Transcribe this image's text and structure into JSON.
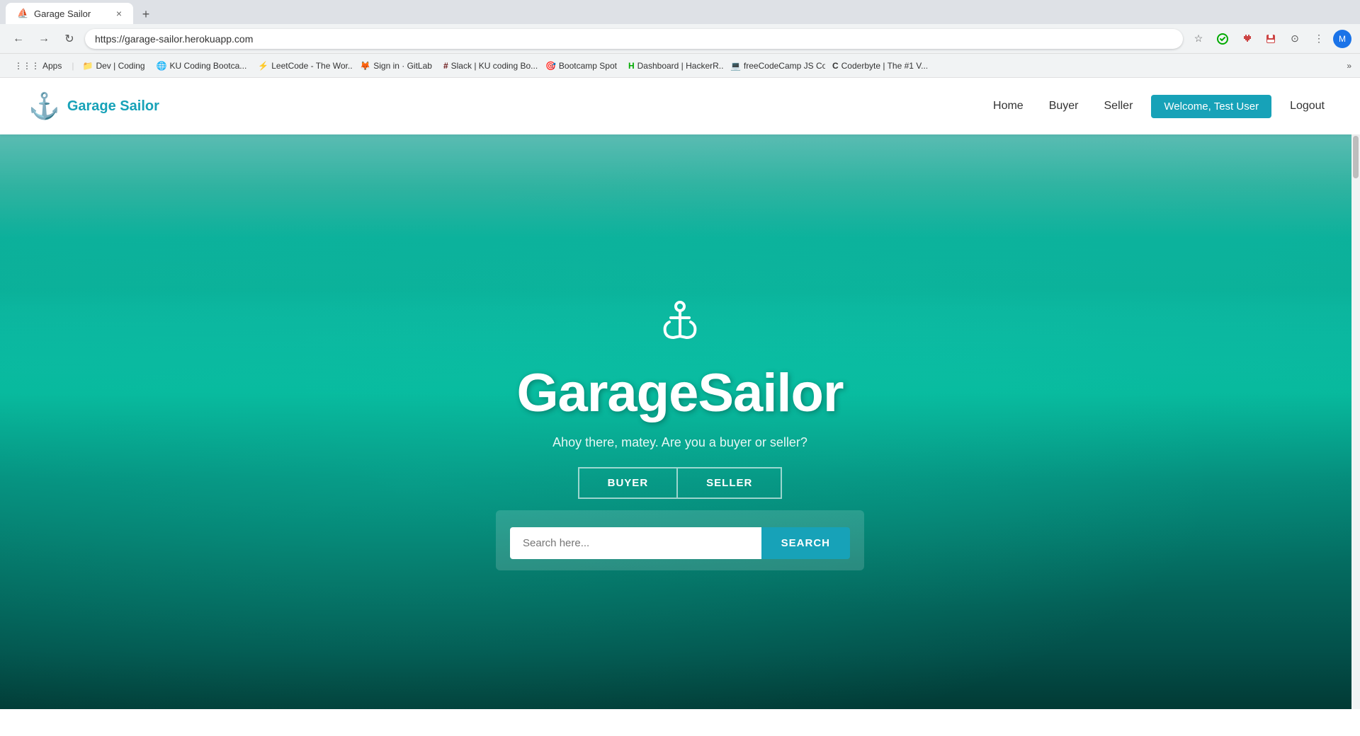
{
  "browser": {
    "tab": {
      "favicon": "⛵",
      "title": "Garage Sailor",
      "close": "×"
    },
    "new_tab": "+",
    "address": "https://garage-sailor.herokuapp.com",
    "nav": {
      "back": "←",
      "forward": "→",
      "refresh": "↻",
      "home": ""
    },
    "icons": {
      "star": "☆",
      "extensions": "",
      "more": "⋮"
    },
    "profile_initial": "M"
  },
  "bookmarks": {
    "apps_label": "Apps",
    "items": [
      {
        "icon": "📁",
        "label": "Dev | Coding"
      },
      {
        "icon": "🌐",
        "label": "KU Coding Bootca..."
      },
      {
        "icon": "⚡",
        "label": "LeetCode - The Wor..."
      },
      {
        "icon": "🦊",
        "label": "Sign in · GitLab"
      },
      {
        "icon": "#",
        "label": "Slack | KU coding Bo..."
      },
      {
        "icon": "🎯",
        "label": "Bootcamp Spot"
      },
      {
        "icon": "H",
        "label": "Dashboard | HackerR..."
      },
      {
        "icon": "💻",
        "label": "freeCodeCamp JS Co..."
      },
      {
        "icon": "C",
        "label": "Coderbyte | The #1 V..."
      }
    ],
    "more": "»"
  },
  "site": {
    "logo_icon": "⚓",
    "logo_text": "Garage Sailor",
    "nav_links": [
      {
        "label": "Home",
        "key": "home"
      },
      {
        "label": "Buyer",
        "key": "buyer"
      },
      {
        "label": "Seller",
        "key": "seller"
      }
    ],
    "user_button": "Welcome, Test User",
    "logout_link": "Logout"
  },
  "hero": {
    "anchor_icon": "⚓",
    "title": "GarageSailor",
    "subtitle": "Ahoy there, matey. Are you a buyer or seller?",
    "buyer_btn": "BUYER",
    "seller_btn": "SELLER",
    "search_placeholder": "Search here...",
    "search_button": "SEARCH"
  }
}
